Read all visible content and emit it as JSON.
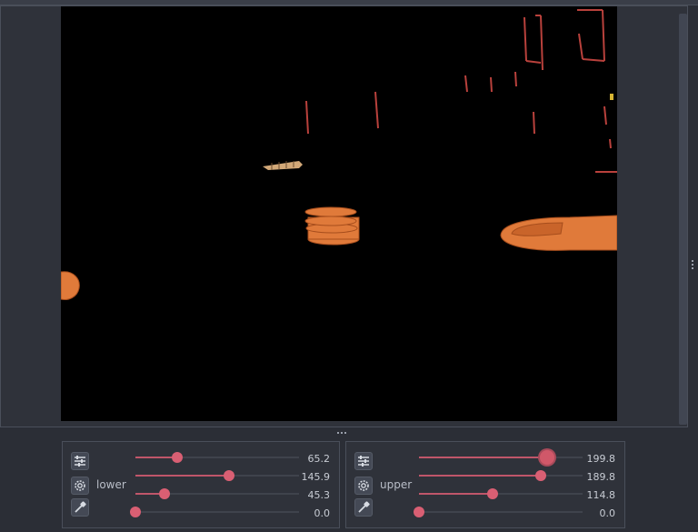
{
  "panels": {
    "lower": {
      "label": "lower",
      "sliders": [
        {
          "value": "65.2",
          "fraction": 0.256
        },
        {
          "value": "145.9",
          "fraction": 0.572
        },
        {
          "value": "45.3",
          "fraction": 0.178
        },
        {
          "value": "0.0",
          "fraction": 0.0
        }
      ]
    },
    "upper": {
      "label": "upper",
      "sliders": [
        {
          "value": "199.8",
          "fraction": 0.784
        },
        {
          "value": "189.8",
          "fraction": 0.744
        },
        {
          "value": "114.8",
          "fraction": 0.45
        },
        {
          "value": "0.0",
          "fraction": 0.0
        }
      ]
    }
  },
  "icons": {
    "tune": "sliders-icon",
    "settings": "gear-icon",
    "picker": "eyedropper-icon"
  },
  "colors": {
    "accent": "#d95f73",
    "background": "#2b2e36",
    "canvas": "#000000",
    "object": "#e07a3a"
  }
}
